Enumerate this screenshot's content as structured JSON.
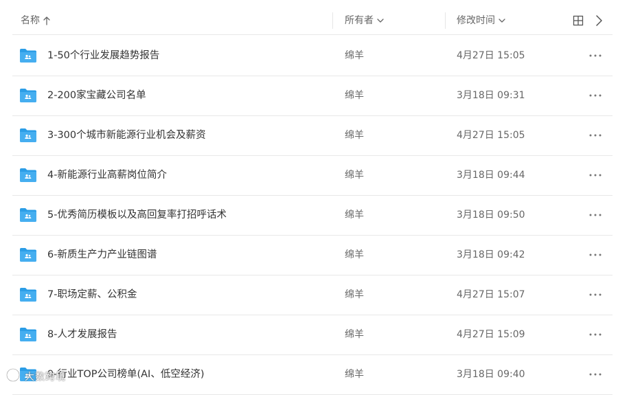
{
  "columns": {
    "name": "名称",
    "owner": "所有者",
    "time": "修改时间"
  },
  "icons": {
    "sort": "arrow-up-icon",
    "dropdown": "chevron-down-icon",
    "grid": "grid-view-icon",
    "collapse": "chevron-right-icon",
    "folder": "shared-folder-icon",
    "more": "more-horizontal-icon"
  },
  "colors": {
    "folder": "#2b9de6",
    "border": "#e8e8e8",
    "text": "#333333",
    "muted": "#666666"
  },
  "files": [
    {
      "name": "1-50个行业发展趋势报告",
      "owner": "绵羊",
      "time": "4月27日 15:05"
    },
    {
      "name": "2-200家宝藏公司名单",
      "owner": "绵羊",
      "time": "3月18日 09:31"
    },
    {
      "name": "3-300个城市新能源行业机会及薪资",
      "owner": "绵羊",
      "time": "4月27日 15:05"
    },
    {
      "name": "4-新能源行业高薪岗位简介",
      "owner": "绵羊",
      "time": "3月18日 09:44"
    },
    {
      "name": "5-优秀简历模板以及高回复率打招呼话术",
      "owner": "绵羊",
      "time": "3月18日 09:50"
    },
    {
      "name": "6-新质生产力产业链图谱",
      "owner": "绵羊",
      "time": "3月18日 09:42"
    },
    {
      "name": "7-职场定薪、公积金",
      "owner": "绵羊",
      "time": "4月27日 15:07"
    },
    {
      "name": "8-人才发展报告",
      "owner": "绵羊",
      "time": "4月27日 15:09"
    },
    {
      "name": "9-行业TOP公司榜单(AI、低空经济)",
      "owner": "绵羊",
      "time": "3月18日 09:40"
    }
  ],
  "watermark": {
    "text": "大数跨境"
  }
}
